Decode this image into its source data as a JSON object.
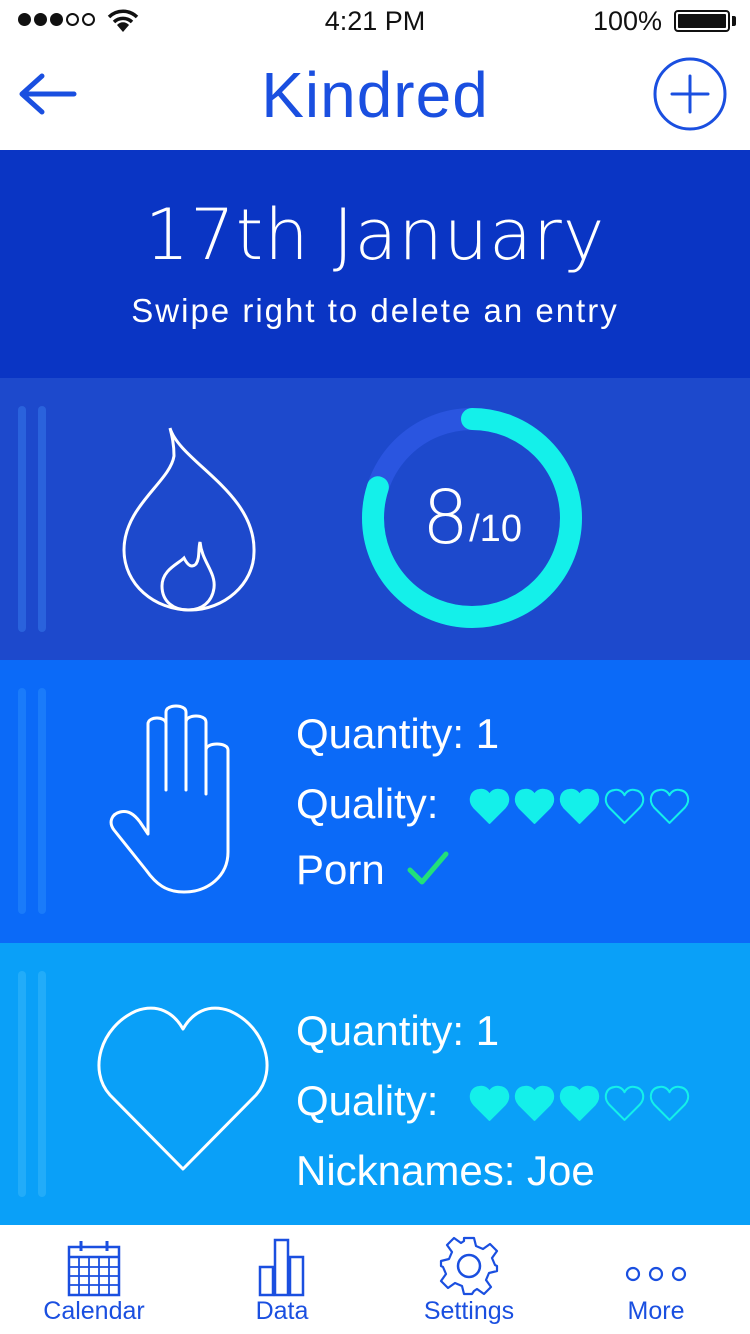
{
  "status_bar": {
    "time": "4:21 PM",
    "battery": "100%"
  },
  "nav": {
    "title": "Kindred",
    "back_icon": "arrow-left-icon",
    "add_icon": "plus-circle-icon"
  },
  "date_header": {
    "title": "17th January",
    "hint": "Swipe right to delete an entry"
  },
  "desire_card": {
    "icon": "flame-icon",
    "score": "8",
    "total": "/10",
    "progress": 0.8
  },
  "solo_card": {
    "icon": "hand-icon",
    "quantity": "Quantity: 1",
    "quality_label": "Quality:",
    "quality_rating": 3,
    "quality_max": 5,
    "porn_label": "Porn",
    "porn_checked": true
  },
  "partner_card": {
    "icon": "heart-icon",
    "quantity": "Quantity: 1",
    "quality_label": "Quality:",
    "quality_rating": 3,
    "quality_max": 5,
    "nicknames": "Nicknames: Joe"
  },
  "tabbar": {
    "tabs": [
      {
        "label": "Calendar",
        "icon": "calendar-icon"
      },
      {
        "label": "Data",
        "icon": "bar-chart-icon"
      },
      {
        "label": "Settings",
        "icon": "gear-icon"
      },
      {
        "label": "More",
        "icon": "more-dots-icon"
      }
    ]
  },
  "colors": {
    "accent": "#1a4fe0",
    "header_bg": "#0a35c4",
    "desire_bg": "#1d49cc",
    "solo_bg": "#0b6af8",
    "partner_bg": "#0aa0f8",
    "ring_fill": "#14f0ea",
    "ring_track": "#2a55e0",
    "heart_fill": "#14f0ea",
    "check": "#22e07a"
  }
}
